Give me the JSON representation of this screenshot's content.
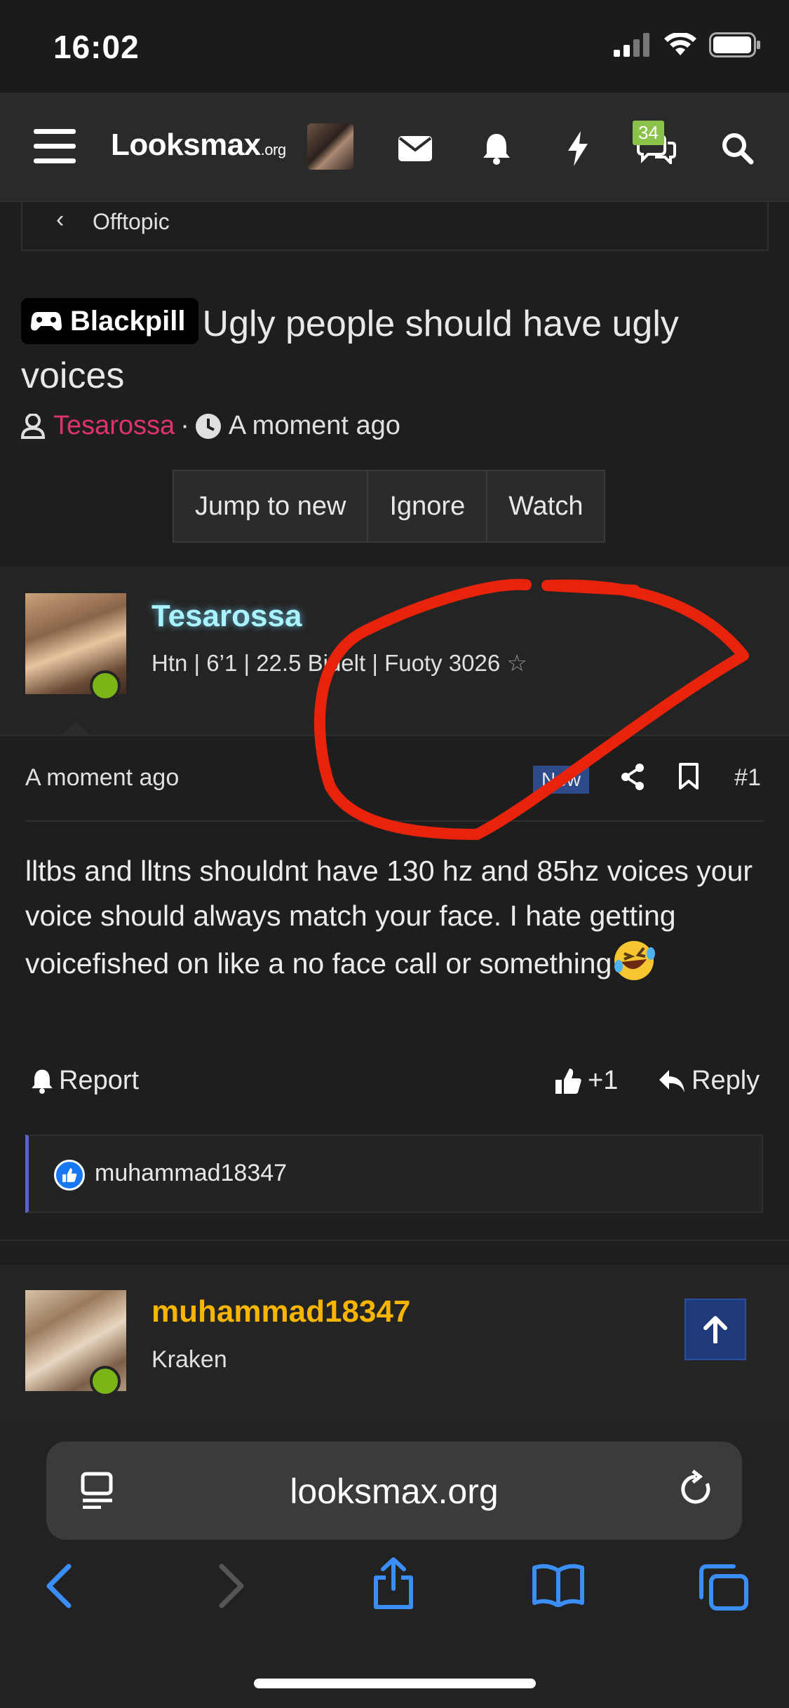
{
  "status_bar": {
    "time": "16:02"
  },
  "header": {
    "logo_main": "Looksmax",
    "logo_suffix": ".org",
    "conversations_badge": "34"
  },
  "breadcrumb": {
    "label": "Offtopic"
  },
  "thread": {
    "prefix": "Blackpill",
    "title": "Ugly people should have ugly voices",
    "author": "Tesarossa",
    "separator": "·",
    "time": "A moment ago",
    "buttons": [
      "Jump to new",
      "Ignore",
      "Watch"
    ]
  },
  "post": {
    "username": "Tesarossa",
    "user_title": "Htn | 6’1 | 22.5  Bidelt | Fuoty 3026",
    "time": "A moment ago",
    "new_label": "New",
    "post_number": "#1",
    "body": "lltbs and lltns shouldnt have 130 hz and 85hz voices your voice should always match your face. I hate getting voicefished on like a no face call or something",
    "report_label": "Report",
    "reaction_count": "+1",
    "reply_label": "Reply",
    "liker": "muhammad18347"
  },
  "post2": {
    "username": "muhammad18347",
    "user_title": "Kraken"
  },
  "safari": {
    "url": "looksmax.org"
  },
  "colors": {
    "author_pink": "#e0336b",
    "username_cyan": "#a8f3ff",
    "username_gold": "#f7b500",
    "online_green": "#7cb518",
    "badge_green": "#8bc34a",
    "annotation_red": "#e8230c",
    "safari_blue": "#3a8ef6"
  },
  "icons": [
    "hamburger-icon",
    "envelope-icon",
    "bell-icon",
    "bolt-icon",
    "chat-icon",
    "search-icon",
    "chevron-left-icon",
    "user-icon",
    "clock-icon",
    "share-icon",
    "bookmark-icon",
    "thumbs-up-icon",
    "reply-icon",
    "arrow-up-icon",
    "reader-icon",
    "reload-icon",
    "back-icon",
    "forward-icon",
    "share-sheet-icon",
    "bookmarks-icon",
    "tabs-icon"
  ]
}
